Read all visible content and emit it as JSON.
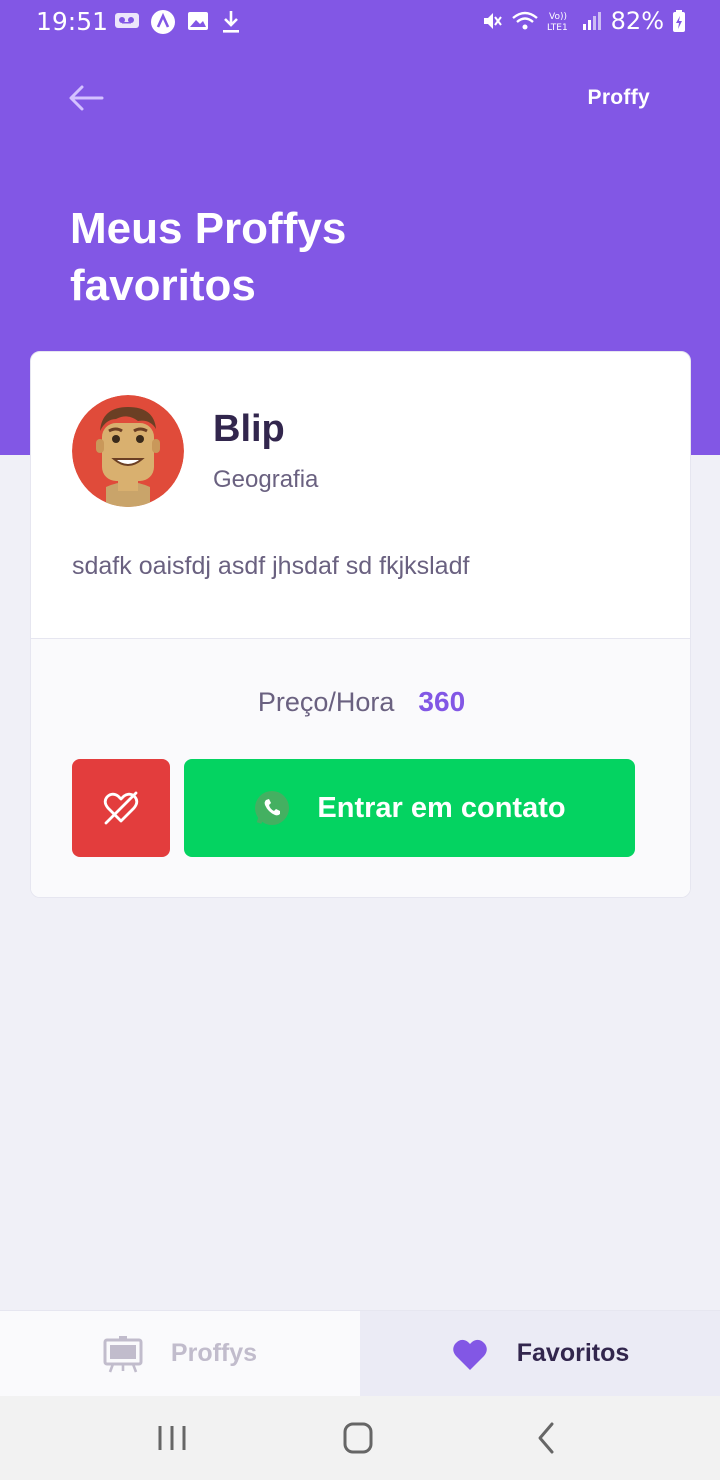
{
  "status_bar": {
    "time": "19:51",
    "battery": "82%",
    "icons": [
      "voicemail-icon",
      "app-notification-icon",
      "gallery-icon",
      "download-icon",
      "mute-icon",
      "wifi-icon",
      "volte-icon",
      "signal-icon",
      "battery-icon"
    ]
  },
  "header": {
    "back_icon": "arrow-left-icon",
    "logo": "Proffy",
    "title": "Meus Proffys favoritos",
    "background": "#8257e5"
  },
  "card": {
    "name": "Blip",
    "subject": "Geografia",
    "bio": "sdafk oaisfdj asdf jhsdaf sd fkjksladf",
    "price_label": "Preço/Hora",
    "price_value": "360",
    "unfavorite_icon": "heart-outline-crossed-icon",
    "contact_label": "Entrar em contato",
    "contact_icon": "whatsapp-icon",
    "colors": {
      "unfavorite": "#e33d3d",
      "contact": "#04d361",
      "price": "#8257e5"
    }
  },
  "tabs": [
    {
      "label": "Proffys",
      "icon": "easel-icon",
      "active": false
    },
    {
      "label": "Favoritos",
      "icon": "heart-icon",
      "active": true
    }
  ],
  "system_nav": [
    "recents-icon",
    "home-icon",
    "back-icon"
  ]
}
